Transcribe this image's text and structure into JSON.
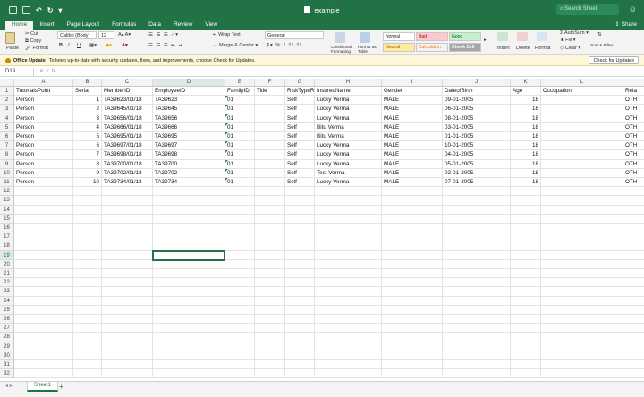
{
  "window": {
    "title": "example",
    "search_placeholder": "Search Sheet",
    "share_label": "Share"
  },
  "ribbon_tabs": [
    "Home",
    "Insert",
    "Page Layout",
    "Formulas",
    "Data",
    "Review",
    "View"
  ],
  "ribbon": {
    "paste": "Paste",
    "cut": "Cut",
    "copy": "Copy",
    "format": "Format",
    "font_name": "Calibri (Body)",
    "font_size": "12",
    "wrap_text": "Wrap Text",
    "merge_center": "Merge & Center",
    "number_format": "General",
    "conditional_formatting": "Conditional Formatting",
    "format_as_table": "Format as Table",
    "styles": [
      "Normal",
      "Bad",
      "Good",
      "Neutral",
      "Calculation",
      "Check Cell"
    ],
    "insert": "Insert",
    "delete": "Delete",
    "format_cells": "Format",
    "autosum": "AutoSum",
    "fill": "Fill",
    "clear": "Clear",
    "sort_filter": "Sort & Filter"
  },
  "update_bar": {
    "title": "Office Update",
    "message": "To keep up-to-date with security updates, fixes, and improvements, choose Check for Updates.",
    "button": "Check for Updates"
  },
  "formula_bar": {
    "name_box": "D19",
    "fx": "fx",
    "content": ""
  },
  "columns": [
    "A",
    "B",
    "C",
    "D",
    "E",
    "F",
    "G",
    "H",
    "I",
    "J",
    "K",
    "L"
  ],
  "selected_column": "D",
  "selected_row": 19,
  "row_count": 32,
  "header_row": [
    "TutorialsPoint",
    "Serial",
    "MemberID",
    "EmployeeID",
    "FamilyID",
    "Title",
    "RiskTypeR",
    "InsuredName",
    "Gender",
    "DateofBirth",
    "Age",
    "Occupation",
    "Rela"
  ],
  "rows": [
    [
      "Person",
      "1",
      "TA39623/01/18",
      "TA39623",
      "01",
      "",
      "Self",
      "Lucky Verma",
      "MALE",
      "09-01-2005",
      "18",
      "",
      "OTH"
    ],
    [
      "Person",
      "2",
      "TA39645/01/18",
      "TA39645",
      "01",
      "",
      "Self",
      "Lucky Verma",
      "MALE",
      "06-01-2005",
      "18",
      "",
      "OTH"
    ],
    [
      "Person",
      "3",
      "TA39656/01/18",
      "TA39656",
      "01",
      "",
      "Self",
      "Lucky Verma",
      "MALE",
      "08-01-2005",
      "18",
      "",
      "OTH"
    ],
    [
      "Person",
      "4",
      "TA39666/01/18",
      "TA39666",
      "01",
      "",
      "Self",
      "Bitu Verma",
      "MALE",
      "03-01-2005",
      "18",
      "",
      "OTH"
    ],
    [
      "Person",
      "5",
      "TA39695/01/18",
      "TA39695",
      "01",
      "",
      "Self",
      "Bitu Verma",
      "MALE",
      "01-01-2005",
      "18",
      "",
      "OTH"
    ],
    [
      "Person",
      "6",
      "TA39697/01/18",
      "TA39697",
      "01",
      "",
      "Self",
      "Lucky Verma",
      "MALE",
      "10-01-2005",
      "18",
      "",
      "OTH"
    ],
    [
      "Person",
      "7",
      "TA39698/01/18",
      "TA39698",
      "01",
      "",
      "Self",
      "Lucky Verma",
      "MALE",
      "04-01-2005",
      "18",
      "",
      "OTH"
    ],
    [
      "Person",
      "8",
      "TA39700/01/18",
      "TA39700",
      "01",
      "",
      "Self",
      "Lucky Verma",
      "MALE",
      "05-01-2005",
      "18",
      "",
      "OTH"
    ],
    [
      "Person",
      "9",
      "TA39702/01/18",
      "TA39702",
      "01",
      "",
      "Self",
      "Test Verma",
      "MALE",
      "02-01-2005",
      "18",
      "",
      "OTH"
    ],
    [
      "Person",
      "10",
      "TA39734/01/18",
      "TA39734",
      "01",
      "",
      "Self",
      "Lucky Verma",
      "MALE",
      "07-01-2005",
      "18",
      "",
      "OTH"
    ]
  ],
  "sheets": [
    "Sheet1"
  ],
  "colors": {
    "accent": "#217346",
    "update_bar": "#fdf6d8",
    "bad": "#ffc7ce",
    "good": "#c6efce",
    "neutral": "#ffeb9c"
  }
}
